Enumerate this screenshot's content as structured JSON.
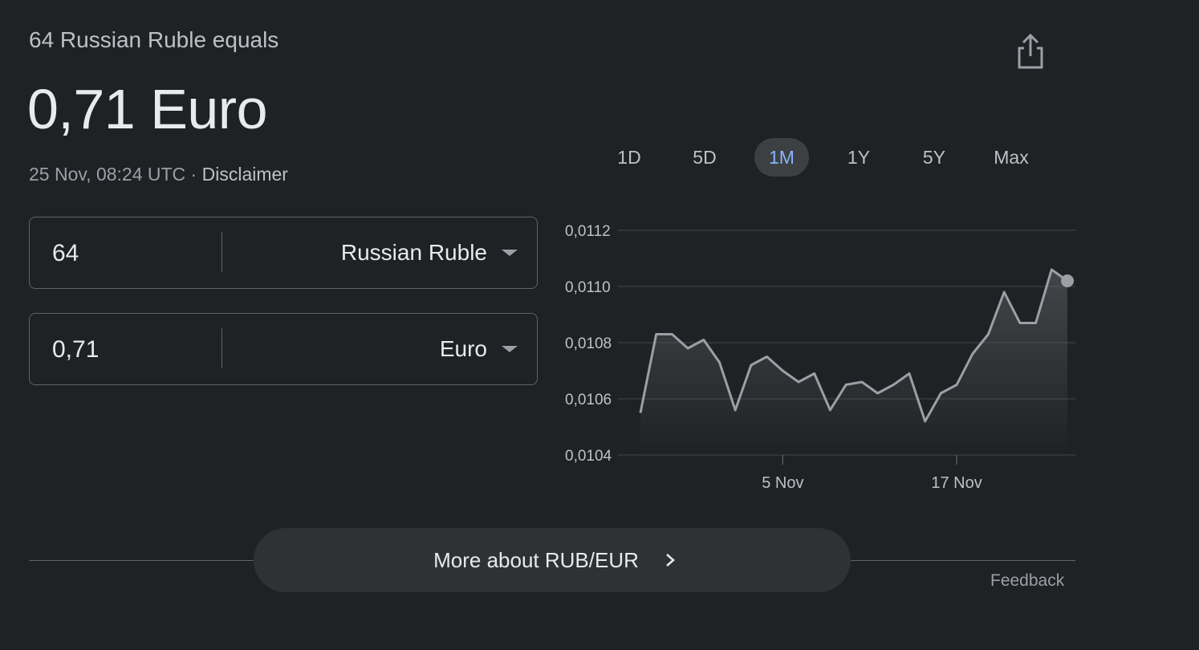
{
  "header": {
    "subtitle": "64 Russian Ruble equals",
    "result": "0,71 Euro",
    "timestamp": "25 Nov, 08:24 UTC · ",
    "disclaimer": "Disclaimer",
    "share_icon": "share-icon"
  },
  "converter": {
    "from": {
      "amount": "64",
      "currency": "Russian Ruble"
    },
    "to": {
      "amount": "0,71",
      "currency": "Euro"
    }
  },
  "ranges": [
    {
      "label": "1D",
      "active": false
    },
    {
      "label": "5D",
      "active": false
    },
    {
      "label": "1M",
      "active": true
    },
    {
      "label": "1Y",
      "active": false
    },
    {
      "label": "5Y",
      "active": false
    },
    {
      "label": "Max",
      "active": false
    }
  ],
  "colors": {
    "background": "#202124",
    "accent": "#8ab4f8",
    "line": "#9aa0a6"
  },
  "chart_data": {
    "type": "area",
    "series_points": [
      0.01055,
      0.01083,
      0.01083,
      0.01078,
      0.01081,
      0.01073,
      0.01056,
      0.01072,
      0.01075,
      0.0107,
      0.01066,
      0.01069,
      0.01056,
      0.01065,
      0.01066,
      0.01062,
      0.01065,
      0.01069,
      0.01052,
      0.01062,
      0.01065,
      0.01076,
      0.01083,
      0.01098,
      0.01087,
      0.01087,
      0.01106,
      0.01102
    ],
    "ylim": [
      0.0104,
      0.0112
    ],
    "yticks": [
      "0,0112",
      "0,0110",
      "0,0108",
      "0,0106",
      "0,0104"
    ],
    "xtick_labels": [
      {
        "label": "5 Nov",
        "index": 9
      },
      {
        "label": "17 Nov",
        "index": 20
      }
    ],
    "grid": true
  },
  "footer": {
    "more_label": "More about RUB/EUR",
    "feedback": "Feedback"
  }
}
